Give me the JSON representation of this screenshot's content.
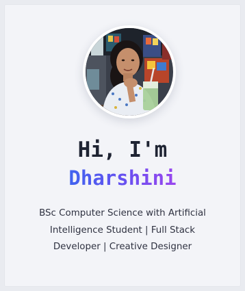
{
  "profile": {
    "greeting": "Hi, I'm",
    "name": "Dharshini",
    "tagline": "BSc Computer Science with Artificial Intelligence Student | Full Stack Developer | Creative Designer",
    "photo_alt": "Profile photo"
  },
  "colors": {
    "name_gradient_start": "#3f63ef",
    "name_gradient_end": "#9a46ee",
    "heading": "#1f2433",
    "text": "#2e3140",
    "background": "#f3f4f8"
  }
}
